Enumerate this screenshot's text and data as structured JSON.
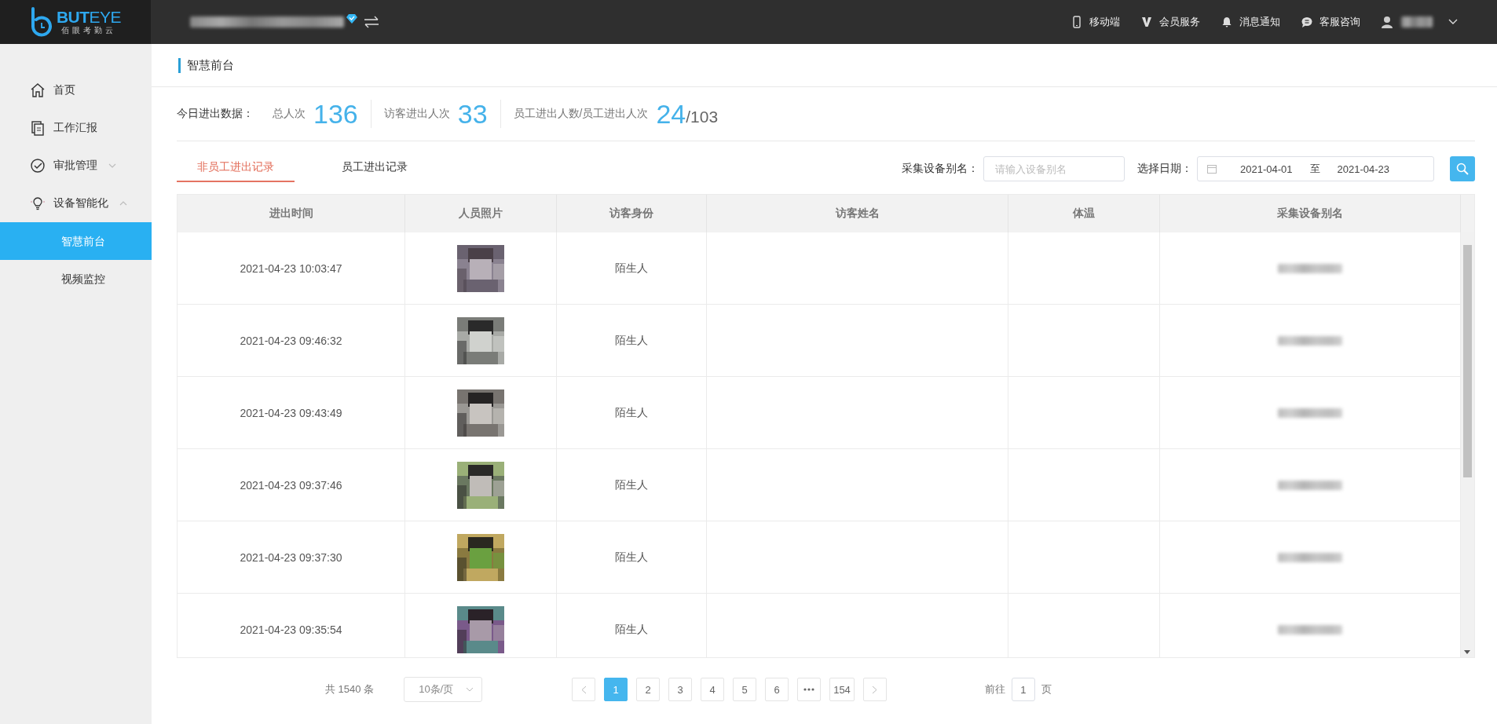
{
  "logo": {
    "name": "**BUT**EYE",
    "tagline": "佰眼考勤云"
  },
  "top_nav": [
    {
      "label": "移动端"
    },
    {
      "label": "会员服务"
    },
    {
      "label": "消息通知"
    },
    {
      "label": "客服咨询"
    }
  ],
  "sidebar": {
    "items": [
      {
        "label": "首页"
      },
      {
        "label": "工作汇报"
      },
      {
        "label": "审批管理",
        "expanded": false
      },
      {
        "label": "设备智能化",
        "expanded": true,
        "children": [
          {
            "label": "智慧前台",
            "selected": true
          },
          {
            "label": "视频监控",
            "selected": false
          }
        ]
      }
    ]
  },
  "page_title": "智慧前台",
  "stats": {
    "label": "今日进出数据：",
    "items": [
      {
        "label": "总人次",
        "value": "136"
      },
      {
        "label": "访客进出人次",
        "value": "33"
      },
      {
        "label": "员工进出人数/员工进出人次",
        "value": "24",
        "total": "/103"
      }
    ]
  },
  "tabs": [
    {
      "label": "非员工进出记录",
      "selected": true
    },
    {
      "label": "员工进出记录",
      "selected": false
    }
  ],
  "filters": {
    "device_label": "采集设备别名：",
    "device_placeholder": "请输入设备别名",
    "date_label": "选择日期：",
    "date_from": "2021-04-01",
    "date_separator": "至",
    "date_to": "2021-04-23"
  },
  "table": {
    "columns": [
      "进出时间",
      "人员照片",
      "访客身份",
      "访客姓名",
      "体温",
      "采集设备别名"
    ],
    "rows": [
      {
        "time": "2021-04-23 10:03:47",
        "identity": "陌生人"
      },
      {
        "time": "2021-04-23 09:46:32",
        "identity": "陌生人"
      },
      {
        "time": "2021-04-23 09:43:49",
        "identity": "陌生人"
      },
      {
        "time": "2021-04-23 09:37:46",
        "identity": "陌生人"
      },
      {
        "time": "2021-04-23 09:37:30",
        "identity": "陌生人"
      },
      {
        "time": "2021-04-23 09:35:54",
        "identity": "陌生人"
      }
    ]
  },
  "pagination": {
    "total": "共 1540 条",
    "page_size": "10条/页",
    "pages": [
      {
        "kind": "page",
        "label": "1",
        "selected": true
      },
      {
        "kind": "page",
        "label": "2",
        "selected": false
      },
      {
        "kind": "page",
        "label": "3",
        "selected": false
      },
      {
        "kind": "page",
        "label": "4",
        "selected": false
      },
      {
        "kind": "page",
        "label": "5",
        "selected": false
      },
      {
        "kind": "page",
        "label": "6",
        "selected": false
      },
      {
        "kind": "more"
      },
      {
        "kind": "page",
        "label": "154",
        "selected": false
      }
    ],
    "goto_label": "前往",
    "goto_value": "1",
    "goto_suffix": "页"
  }
}
